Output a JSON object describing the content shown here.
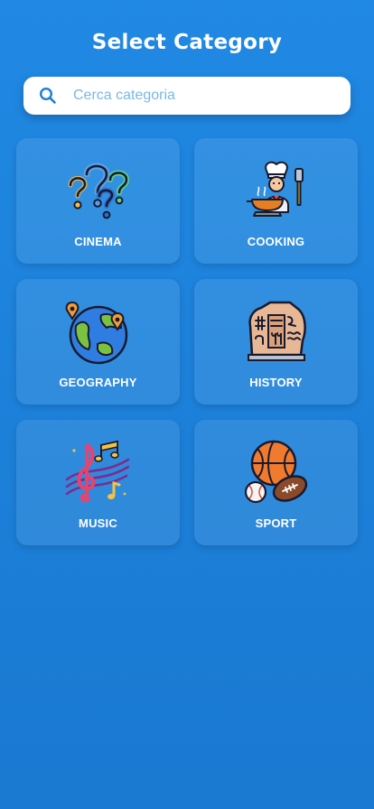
{
  "header": {
    "title": "Select Category"
  },
  "search": {
    "placeholder": "Cerca categoria",
    "icon": "search-icon"
  },
  "categories": [
    {
      "label": "CINEMA",
      "icon": "question-marks-icon"
    },
    {
      "label": "COOKING",
      "icon": "chef-icon"
    },
    {
      "label": "GEOGRAPHY",
      "icon": "globe-pins-icon"
    },
    {
      "label": "HISTORY",
      "icon": "ancient-tablet-icon"
    },
    {
      "label": "MUSIC",
      "icon": "treble-clef-notes-icon"
    },
    {
      "label": "SPORT",
      "icon": "sports-balls-icon"
    }
  ],
  "colors": {
    "background": "#1d82dc",
    "card": "#3a95e4",
    "text": "#ffffff",
    "search_icon": "#1b7fd6"
  }
}
